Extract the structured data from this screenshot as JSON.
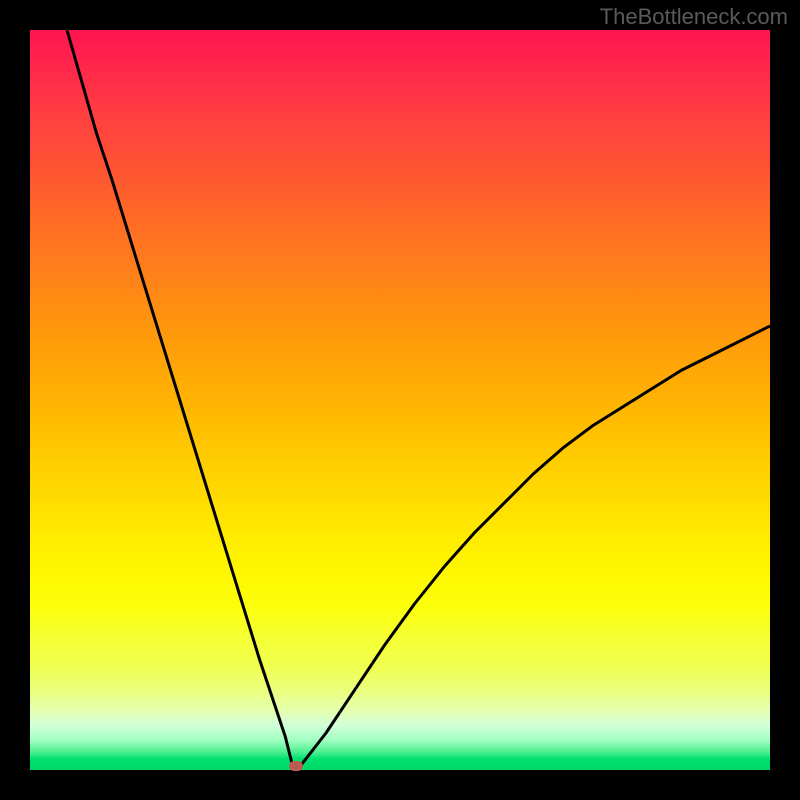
{
  "watermark": "TheBottleneck.com",
  "chart_data": {
    "type": "line",
    "title": "",
    "xlabel": "",
    "ylabel": "",
    "xlim": [
      0,
      100
    ],
    "ylim": [
      0,
      100
    ],
    "grid": false,
    "legend_position": "none",
    "series": [
      {
        "name": "bottleneck-curve",
        "x": [
          5,
          7,
          9,
          11,
          13,
          15,
          17,
          19,
          21,
          23,
          25,
          27,
          29,
          31,
          33,
          34.5,
          35.5,
          36.5,
          40,
          44,
          48,
          52,
          56,
          60,
          64,
          68,
          72,
          76,
          80,
          84,
          88,
          92,
          96,
          100
        ],
        "y": [
          100,
          93,
          86,
          80,
          73.5,
          67,
          60.5,
          54,
          47.5,
          41,
          34.5,
          28,
          21.5,
          15,
          9,
          4.5,
          0.5,
          0.5,
          5,
          11,
          17,
          22.5,
          27.5,
          32,
          36,
          40,
          43.5,
          46.5,
          49,
          51.5,
          54,
          56,
          58,
          60
        ],
        "color": "#000000"
      }
    ],
    "marker": {
      "name": "optimal-point",
      "x": 36,
      "y": 0.5,
      "color": "#bb5c52"
    },
    "background_gradient": {
      "direction": "vertical",
      "stops": [
        {
          "pos": 0,
          "color": "#ff1450"
        },
        {
          "pos": 50,
          "color": "#ffc400"
        },
        {
          "pos": 80,
          "color": "#f8ff30"
        },
        {
          "pos": 100,
          "color": "#00d868"
        }
      ]
    }
  }
}
